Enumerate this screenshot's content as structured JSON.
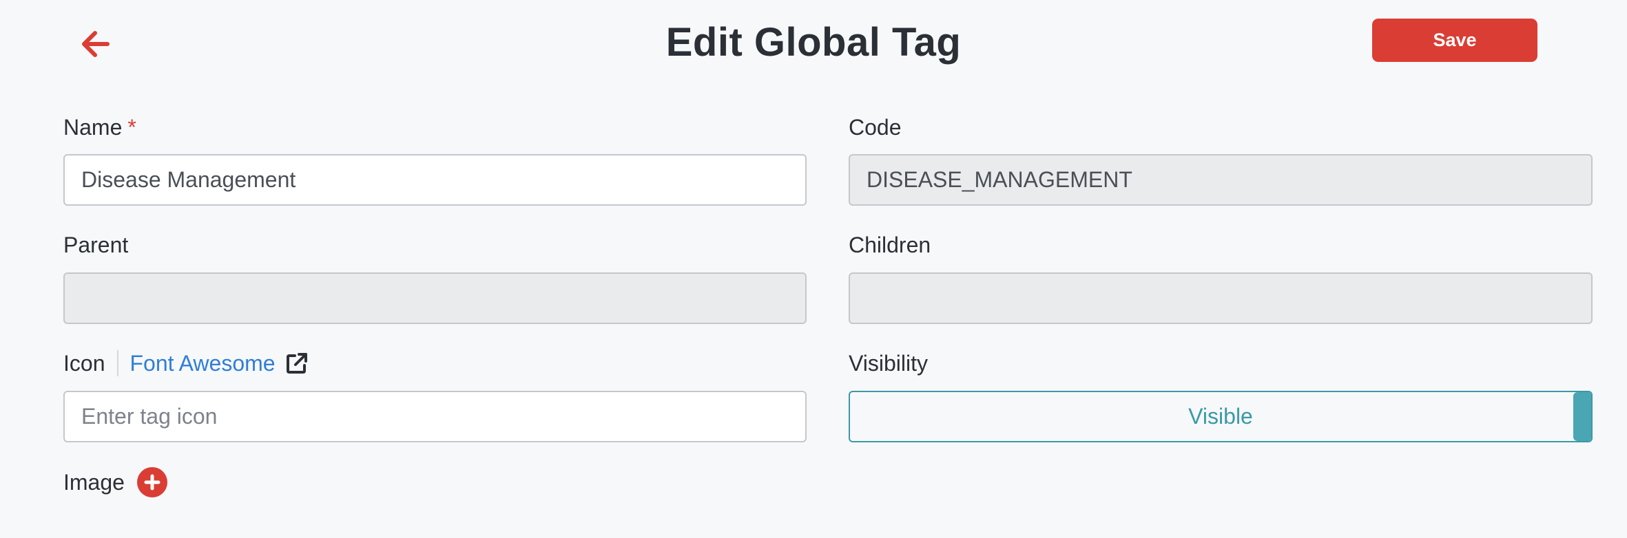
{
  "header": {
    "title": "Edit Global Tag",
    "save_label": "Save",
    "back_icon": "arrow-left-icon"
  },
  "form": {
    "name": {
      "label": "Name",
      "required_marker": "*",
      "value": "Disease Management"
    },
    "code": {
      "label": "Code",
      "value": "DISEASE_MANAGEMENT"
    },
    "parent": {
      "label": "Parent",
      "value": ""
    },
    "children": {
      "label": "Children",
      "value": ""
    },
    "icon": {
      "label": "Icon",
      "link_label": "Font Awesome",
      "link_icon": "external-link-icon",
      "placeholder": "Enter tag icon",
      "value": ""
    },
    "visibility": {
      "label": "Visibility",
      "value": "Visible"
    },
    "image": {
      "label": "Image",
      "add_icon": "plus-circle-icon"
    }
  },
  "colors": {
    "accent_red": "#da3d34",
    "link_blue": "#2f7ed8",
    "teal": "#3a9aa6",
    "background": "#f7f8fa"
  }
}
